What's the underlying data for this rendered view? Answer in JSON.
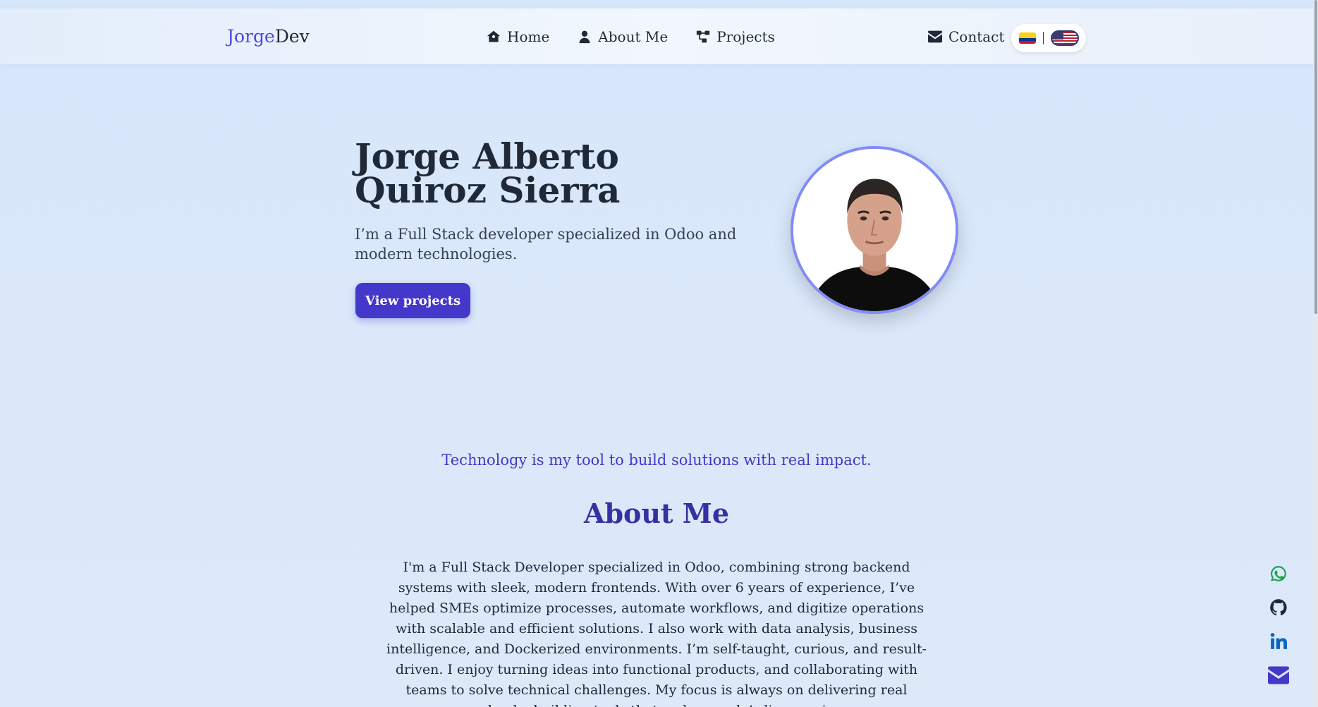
{
  "nav": {
    "logo_part1": "Jorge",
    "logo_part2": "Dev",
    "links": [
      {
        "label": "Home",
        "icon": "home-icon"
      },
      {
        "label": "About Me",
        "icon": "user-icon"
      },
      {
        "label": "Projects",
        "icon": "projects-icon"
      }
    ],
    "contact": "Contact",
    "languages": [
      "es-flag-colombia",
      "en-flag-usa"
    ]
  },
  "hero": {
    "name": "Jorge Alberto Quiroz Sierra",
    "subtitle": "I’m a Full Stack developer specialized in Odoo and modern technologies.",
    "button": "View projects"
  },
  "about": {
    "tagline": "Technology is my tool to build solutions with real impact.",
    "title": "About Me",
    "text": "I'm a Full Stack Developer specialized in Odoo, combining strong backend systems with sleek, modern frontends. With over 6 years of experience, I’ve helped SMEs optimize processes, automate workflows, and digitize operations with scalable and efficient solutions. I also work with data analysis, business intelligence, and Dockerized environments. I’m self-taught, curious, and result-driven. I enjoy turning ideas into functional products, and collaborating with teams to solve technical challenges. My focus is always on delivering real value by building tools that make people’s lives easier"
  },
  "social": [
    "whatsapp-icon",
    "github-icon",
    "linkedin-icon",
    "mail-icon"
  ],
  "colors": {
    "accent": "#4338ca",
    "whatsapp": "#16a34a",
    "linkedin": "#0a66c2"
  }
}
